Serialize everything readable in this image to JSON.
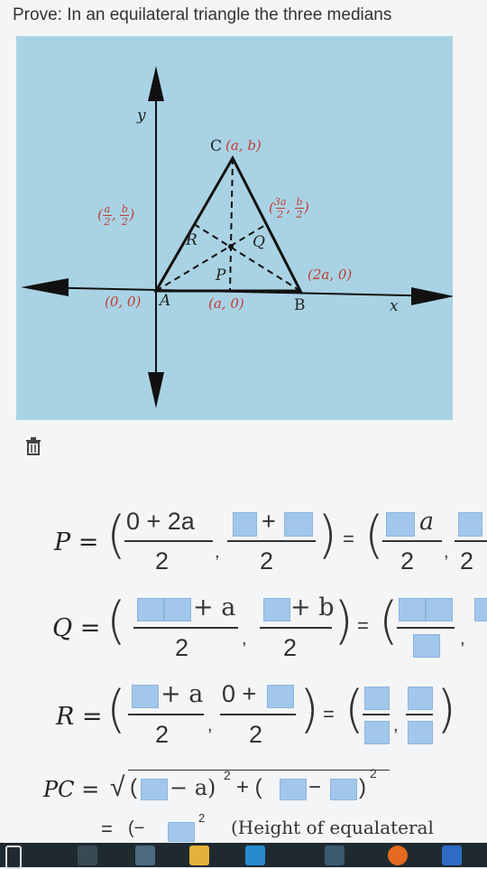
{
  "prompt": "Prove: In an equilateral triangle the three medians",
  "diagram": {
    "axis_y": "y",
    "axis_x": "x",
    "point_C": "C",
    "coord_C": "(a, b)",
    "point_A": "A",
    "coord_A": "(0, 0)",
    "point_B": "B",
    "coord_B": "(2a, 0)",
    "point_P": "P",
    "coord_P": "(a, 0)",
    "point_Q": "Q",
    "point_R": "R",
    "coord_R_x_num": "a",
    "coord_R_x_den": "2",
    "coord_R_y_num": "b",
    "coord_R_y_den": "2",
    "coord_Q_x_num": "3a",
    "coord_Q_x_den": "2",
    "coord_Q_y_num": "b",
    "coord_Q_y_den": "2"
  },
  "equations": {
    "P": {
      "lhs": "P =",
      "num1": "0 + 2a",
      "den1": "2",
      "num2": "+",
      "den2": "2",
      "equals": "=",
      "num3": "a",
      "den3": "2",
      "den4": "2"
    },
    "Q": {
      "lhs": "Q =",
      "num1": "+ a",
      "den1": "2",
      "num2": "+ b",
      "den2": "2",
      "equals": "="
    },
    "R": {
      "lhs": "R =",
      "num1": "+ a",
      "den1": "2",
      "num2": "0 +",
      "den2": "2",
      "equals": "="
    },
    "PC": {
      "lhs": "PC =",
      "sqrt": "√",
      "part1": "(",
      "minus_a": "− a)",
      "sq1": "2",
      "plus": "+ (",
      "minus": "−",
      "close": ")",
      "sq2": "2"
    },
    "next": {
      "lhs": "=",
      "part": "(−",
      "sq": "2",
      "note": "(Height of equalateral"
    }
  }
}
